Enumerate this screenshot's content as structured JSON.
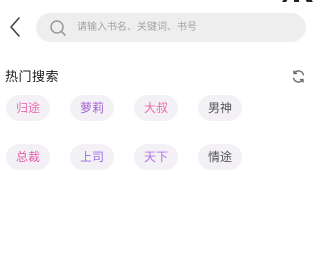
{
  "header": {
    "back_icon": "chevron-left-icon",
    "search": {
      "icon": "search-icon",
      "placeholder": "请输入书名、关键词、书号",
      "value": ""
    }
  },
  "hot_search": {
    "title": "热门搜索",
    "refresh_icon": "refresh-icon",
    "tags": [
      {
        "label": "归途",
        "color": "#e86fb6"
      },
      {
        "label": "萝莉",
        "color": "#a45fd0"
      },
      {
        "label": "大叔",
        "color": "#f06ba6"
      },
      {
        "label": "男神",
        "color": "#555555"
      },
      {
        "label": "总裁",
        "color": "#e05ea9"
      },
      {
        "label": "上司",
        "color": "#9b6ee0"
      },
      {
        "label": "天下",
        "color": "#b66ee6"
      },
      {
        "label": "情途",
        "color": "#555555"
      }
    ]
  }
}
